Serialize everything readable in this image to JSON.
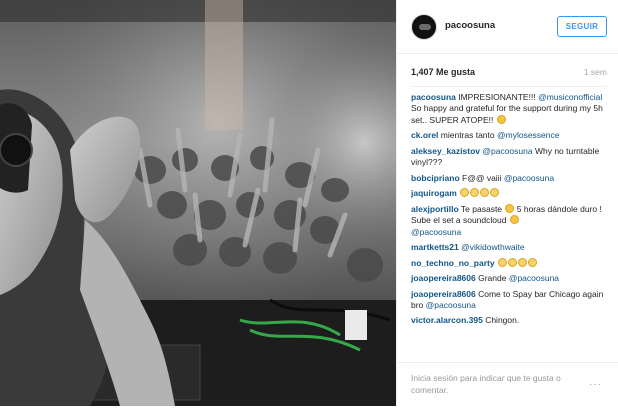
{
  "header": {
    "username": "pacoosuna",
    "follow_label": "SEGUIR"
  },
  "stats": {
    "likes": "1,407 Me gusta",
    "age": "1 sem"
  },
  "caption": {
    "user": "pacoosuna",
    "text1": " IMPRESIONANTE!!! ",
    "mention": "@musiconofficial",
    "text2": " So happy and grateful for the support during my 5h set.. SUPER ATOPE!! "
  },
  "comments": [
    {
      "user": "ck.orel",
      "pre": " mientras tanto ",
      "mention": "@mylosessence",
      "post": ""
    },
    {
      "user": "aleksey_kazistov",
      "pre": " ",
      "mention": "@pacoosuna",
      "post": " Why no turntable vinyl???"
    },
    {
      "user": "bobcipriano",
      "pre": " F@@ vaiii ",
      "mention": "@pacoosuna",
      "post": ""
    },
    {
      "user": "jaquirogam",
      "pre": " ",
      "mention": "",
      "post": ""
    },
    {
      "user": "alexjportillo",
      "pre": " Te pasaste ",
      "mention": "",
      "post": " 5 horas dándole duro ! Sube el set a soundcloud "
    },
    {
      "user": "",
      "pre": "",
      "mention": "@pacoosuna",
      "post": ""
    },
    {
      "user": "martketts21",
      "pre": " ",
      "mention": "@vikidowthwaite",
      "post": ""
    },
    {
      "user": "no_techno_no_party",
      "pre": " ",
      "mention": "",
      "post": ""
    },
    {
      "user": "joaopereira8606",
      "pre": " Grande ",
      "mention": "@pacoosuna",
      "post": ""
    },
    {
      "user": "joaopereira8606",
      "pre": " Come to Spay bar Chicago again bro ",
      "mention": "@pacoosuna",
      "post": ""
    },
    {
      "user": "victor.alarcon.395",
      "pre": " Chingon.",
      "mention": "",
      "post": ""
    }
  ],
  "footer": {
    "login_text": "Inicia sesión para indicar que te gusta o comentar.",
    "more": "···"
  },
  "colors": {
    "link": "#125688",
    "button": "#3897f0",
    "muted": "#999999"
  },
  "icons": {
    "avatar": "profile-avatar",
    "emoji": "emoji-face",
    "more": "more-options-icon"
  }
}
